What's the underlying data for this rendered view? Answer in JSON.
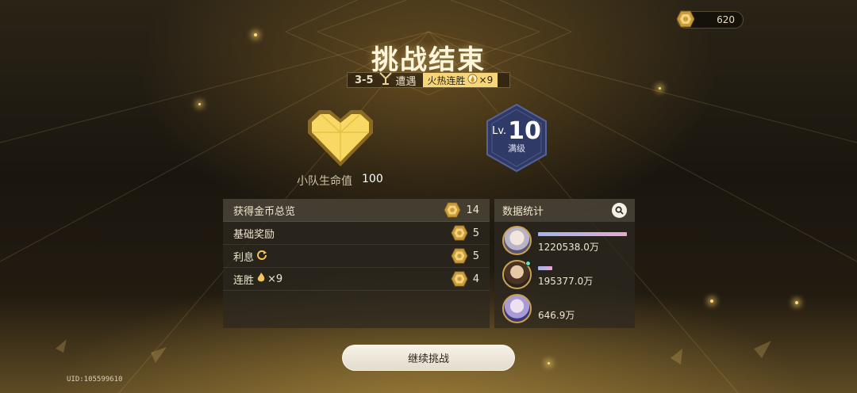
{
  "topbar": {
    "currency_value": "620",
    "currency_icon": "coin-icon"
  },
  "title": "挑战结束",
  "subtitle": {
    "stage": "3-5",
    "event_icon": "branch-icon",
    "event_type": "遭遇",
    "streak_label": "火热连胜",
    "streak_icon": "flame-icon",
    "streak_count": "×9"
  },
  "team_hp": {
    "label": "小队生命值",
    "value": "100",
    "icon": "heart-icon"
  },
  "level": {
    "prefix": "Lv.",
    "value": "10",
    "status": "满级"
  },
  "coins_panel": {
    "header": {
      "label": "获得金币总览",
      "value": "14"
    },
    "rows": [
      {
        "label": "基础奖励",
        "value": "5",
        "icon": ""
      },
      {
        "label": "利息",
        "value": "5",
        "icon": "refresh-icon"
      },
      {
        "label": "连胜",
        "value": "4",
        "icon": "flame-icon",
        "suffix": "×9"
      }
    ]
  },
  "stats_panel": {
    "title": "数据统计",
    "search_icon": "search-icon",
    "entries": [
      {
        "damage": "1220538.0万",
        "bar_fraction": 1.0
      },
      {
        "damage": "195377.0万",
        "bar_fraction": 0.16
      },
      {
        "damage": "646.9万",
        "bar_fraction": 0.0
      }
    ]
  },
  "continue_button": "继续挑战",
  "uid": "UID:105599610",
  "colors": {
    "gold": "#f2c65a",
    "accent_bar_start": "#9fb5ee",
    "accent_bar_end": "#e9a7d2",
    "level_hex": "#2f3a66"
  }
}
